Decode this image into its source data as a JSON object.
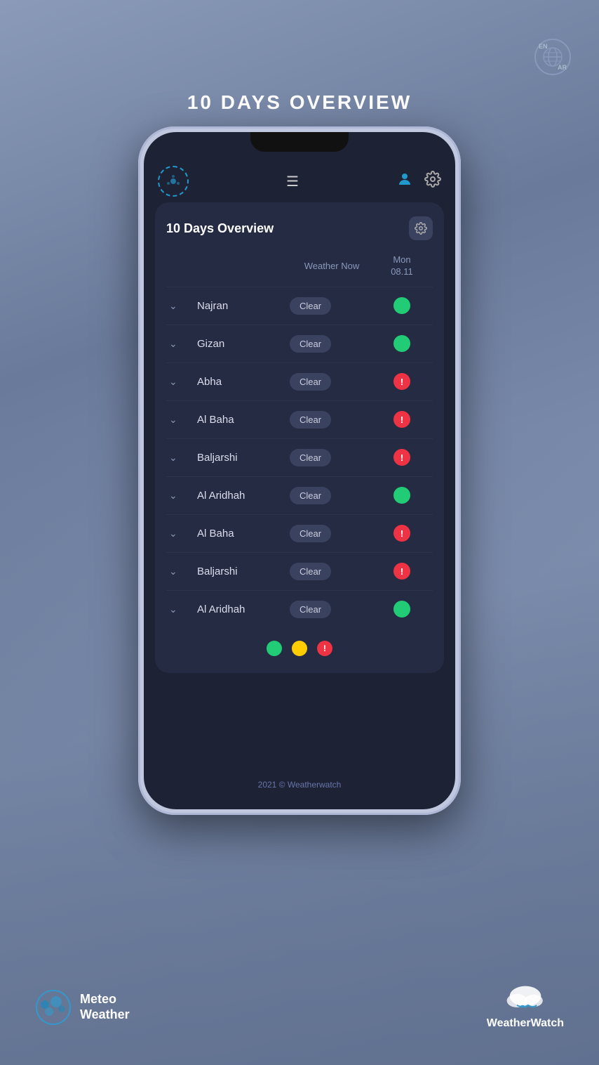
{
  "page": {
    "title": "10 DAYS OVERVIEW",
    "bg_color": "#7a8aaa"
  },
  "lang_toggle": {
    "en": "EN",
    "ar": "AR"
  },
  "phone": {
    "card_title": "10 Days Overview",
    "col_weather_now": "Weather Now",
    "col_day": "Mon",
    "col_date": "08.11",
    "footer": "2021 © Weatherwatch"
  },
  "locations": [
    {
      "name": "Najran",
      "weather": "Clear",
      "status": "green"
    },
    {
      "name": "Gizan",
      "weather": "Clear",
      "status": "green"
    },
    {
      "name": "Abha",
      "weather": "Clear",
      "status": "alert"
    },
    {
      "name": "Al Baha",
      "weather": "Clear",
      "status": "alert"
    },
    {
      "name": "Baljarshi",
      "weather": "Clear",
      "status": "alert"
    },
    {
      "name": "Al Aridhah",
      "weather": "Clear",
      "status": "green"
    },
    {
      "name": "Al Baha",
      "weather": "Clear",
      "status": "alert"
    },
    {
      "name": "Baljarshi",
      "weather": "Clear",
      "status": "alert"
    },
    {
      "name": "Al Aridhah",
      "weather": "Clear",
      "status": "green"
    }
  ],
  "legend": [
    {
      "color": "green",
      "label": "green"
    },
    {
      "color": "yellow",
      "label": "yellow"
    },
    {
      "color": "red",
      "label": "alert"
    }
  ],
  "brand_left": {
    "line1": "Meteo",
    "line2": "Weather"
  },
  "brand_right": {
    "name": "WeatherWatch"
  }
}
